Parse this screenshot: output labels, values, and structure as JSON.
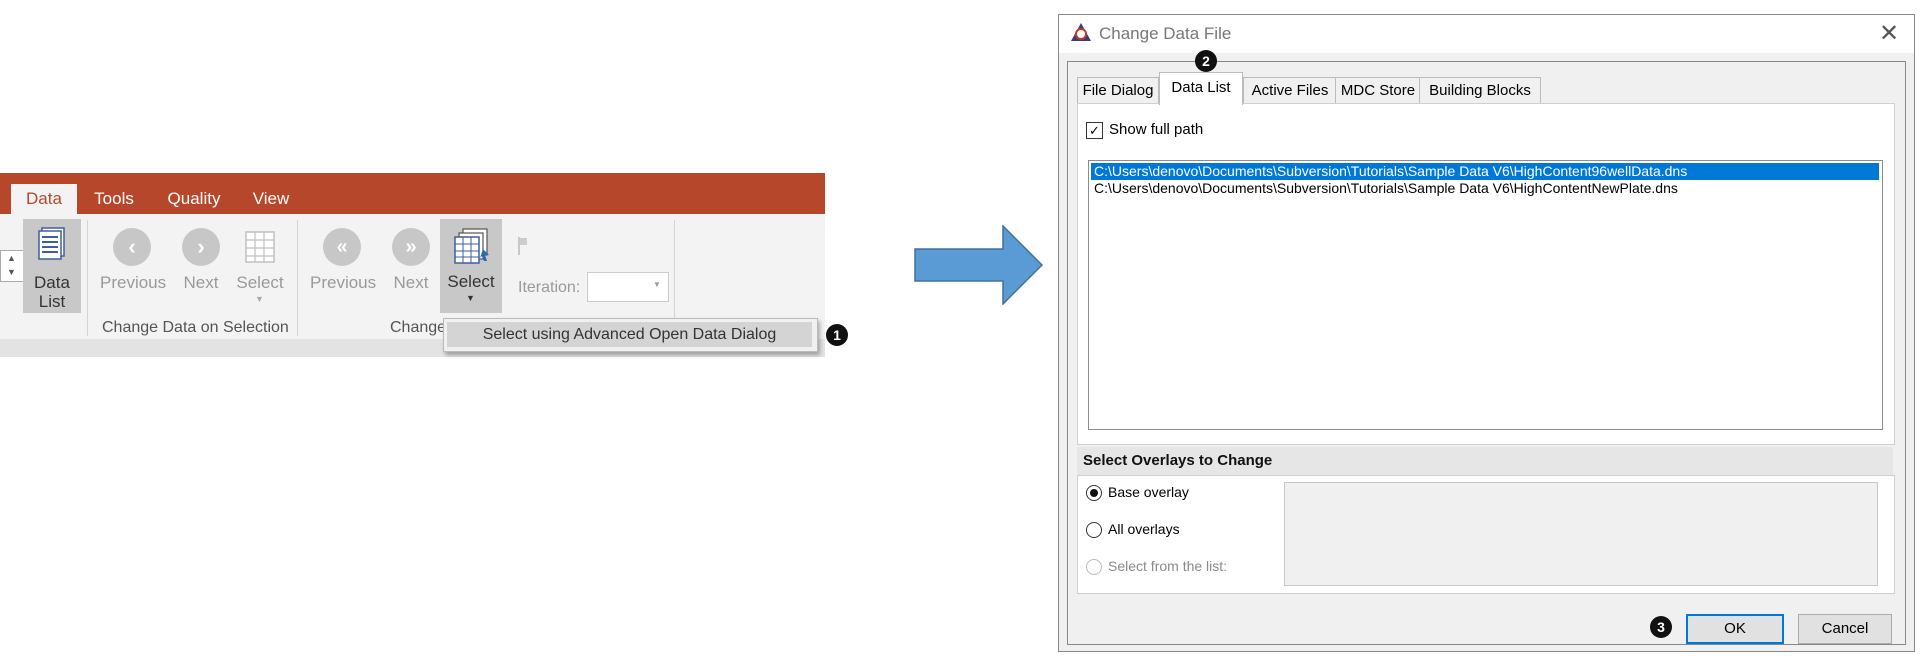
{
  "ribbon": {
    "tabs": [
      {
        "label": "Data",
        "active": true
      },
      {
        "label": "Tools",
        "active": false
      },
      {
        "label": "Quality",
        "active": false
      },
      {
        "label": "View",
        "active": false
      }
    ],
    "data_list_label": "Data\nList",
    "previous_label": "Previous",
    "next_label": "Next",
    "select_label": "Select",
    "previous2_label": "Previous",
    "next2_label": "Next",
    "select2_label": "Select",
    "iteration_label": "Iteration:",
    "group_change_on_selection": "Change Data on Selection",
    "group_change": "Change",
    "popup_item": "Select using Advanced Open Data Dialog",
    "accent_color": "#b7472a"
  },
  "badges": {
    "one": "1",
    "two": "2",
    "three": "3"
  },
  "dialog": {
    "title": "Change Data File",
    "tabs": [
      {
        "label": "File Dialog",
        "active": false
      },
      {
        "label": "Data List",
        "active": true
      },
      {
        "label": "Active Files",
        "active": false
      },
      {
        "label": "MDC Store",
        "active": false
      },
      {
        "label": "Building Blocks",
        "active": false
      }
    ],
    "show_full_path_label": "Show full path",
    "show_full_path_checked": true,
    "files": [
      {
        "path": "C:\\Users\\denovo\\Documents\\Subversion\\Tutorials\\Sample Data V6\\HighContent96wellData.dns",
        "selected": true
      },
      {
        "path": "C:\\Users\\denovo\\Documents\\Subversion\\Tutorials\\Sample Data V6\\HighContentNewPlate.dns",
        "selected": false
      }
    ],
    "overlays_title": "Select Overlays to Change",
    "overlay_options": [
      {
        "label": "Base overlay",
        "checked": true,
        "enabled": true
      },
      {
        "label": "All overlays",
        "checked": false,
        "enabled": true
      },
      {
        "label": "Select from the list:",
        "checked": false,
        "enabled": false
      }
    ],
    "ok_label": "OK",
    "cancel_label": "Cancel"
  }
}
